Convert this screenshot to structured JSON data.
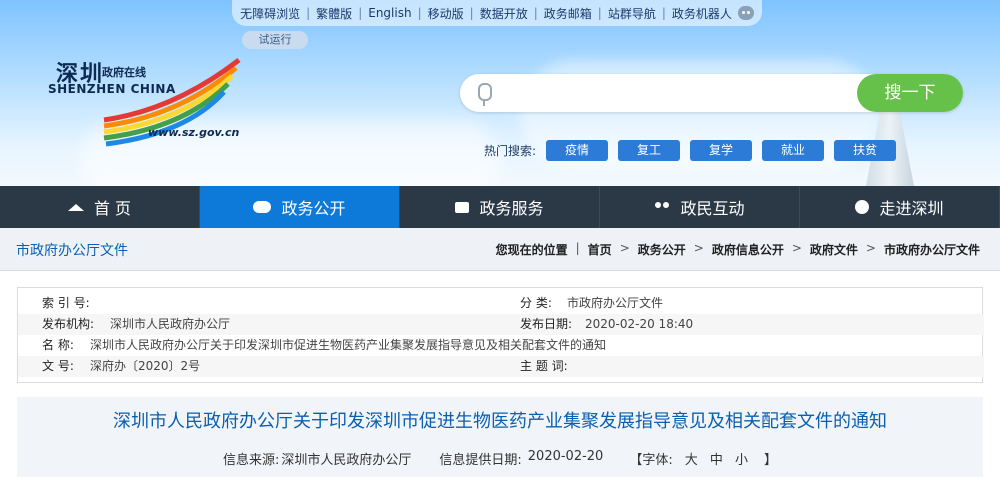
{
  "top_links": [
    "无障碍浏览",
    "繁體版",
    "English",
    "移动版",
    "数据开放",
    "政务邮箱",
    "站群导航",
    "政务机器人"
  ],
  "trial_badge": "试运行",
  "logo": {
    "zh": "深圳",
    "zh_sub": "政府在线",
    "en": "SHENZHEN CHINA",
    "url": "www.sz.gov.cn"
  },
  "search": {
    "placeholder": "",
    "button": "搜一下"
  },
  "hot_search": {
    "label": "热门搜索:",
    "tags": [
      "疫情",
      "复工",
      "复学",
      "就业",
      "扶贫"
    ]
  },
  "nav": [
    {
      "label": "首 页",
      "icon": "home-icon"
    },
    {
      "label": "政务公开",
      "icon": "news-icon",
      "active": true
    },
    {
      "label": "政务服务",
      "icon": "document-icon"
    },
    {
      "label": "政民互动",
      "icon": "people-icon"
    },
    {
      "label": "走进深圳",
      "icon": "chat-icon"
    }
  ],
  "section_title": "市政府办公厅文件",
  "breadcrumb": {
    "prefix": "您现在的位置",
    "items": [
      "首页",
      "政务公开",
      "政府信息公开",
      "政府文件",
      "市政府办公厅文件"
    ]
  },
  "meta": {
    "index_label": "索 引 号:",
    "index_value": "",
    "category_label": "分        类:",
    "category_value": "市政府办公厅文件",
    "publisher_label": "发布机构:",
    "publisher_value": "深圳市人民政府办公厅",
    "date_label": "发布日期:",
    "date_value": "2020-02-20 18:40",
    "name_label": "名        称:",
    "name_value": "深圳市人民政府办公厅关于印发深圳市促进生物医药产业集聚发展指导意见及相关配套文件的通知",
    "docno_label": "文        号:",
    "docno_value": "深府办〔2020〕2号",
    "keywords_label": "主 题 词:",
    "keywords_value": ""
  },
  "article": {
    "title": "深圳市人民政府办公厅关于印发深圳市促进生物医药产业集聚发展指导意见及相关配套文件的通知",
    "source_label": "信息来源:",
    "source_value": "深圳市人民政府办公厅",
    "date_label": "信息提供日期:",
    "date_value": "2020-02-20",
    "font_label": "【字体:",
    "font_sizes": "大 中 小",
    "font_close": "】"
  }
}
